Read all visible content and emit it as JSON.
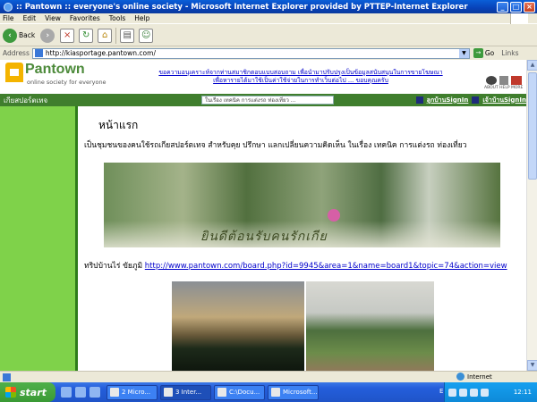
{
  "window": {
    "title": ":: Pantown :: everyone's online society - Microsoft Internet Explorer provided by PTTEP-Internet Explorer"
  },
  "menu": [
    "File",
    "Edit",
    "View",
    "Favorites",
    "Tools",
    "Help"
  ],
  "toolbar": {
    "back_label": "Back"
  },
  "address": {
    "label": "Address",
    "url": "http://kiasportage.pantown.com/",
    "go_label": "Go",
    "links_label": "Links"
  },
  "site": {
    "logo_name": "Pantown",
    "logo_tagline": "online society for everyone",
    "promo_line1": "ขอความอนุเคราะห์จากท่านสมาชิกตอบแบบสอบถาม เพื่อนำมาปรับปรุงเป็นข้อมูลสนับสนุนในการขายโฆษณา",
    "promo_line2": "เพื่อหารายได้มาใช้เป็นค่าใช้จ่ายในการทำเว็บต่อไป ... ขอบคุณครับ",
    "about_badge": "ABOUT HELP MORE",
    "sitename": "เกียสปอร์ตเทจ",
    "search_text": "ในเรื่อง เทคนิค การแต่งรถ ท่องเที่ยว ...",
    "signin_mine": "ลูกบ้านSignIn",
    "signin_owner": "เจ้าบ้านSignIn"
  },
  "page": {
    "title": "หน้าแรก",
    "intro": "เป็นชุมชนของคนใช้รถเกียสปอร์ตเทจ สำหรับคุย ปรึกษา แลกเปลี่ยนความคิดเห็น ในเรื่อง เทคนิค การแต่งรถ ท่องเที่ยว",
    "banner_caption": "ยินดีต้อนรับคนรักเกีย",
    "trip_label": "ทริปบ้านไร่ ขัยภูมิ",
    "trip_link": "http://www.pantown.com/board.php?id=9945&area=1&name=board1&topic=74&action=view"
  },
  "status": {
    "zone": "Internet"
  },
  "taskbar": {
    "start": "start",
    "tasks": [
      "2 Micro...",
      "3 Inter...",
      "C:\\Docu...",
      "Microsoft..."
    ],
    "lang": "EN",
    "clock": "12:11"
  }
}
